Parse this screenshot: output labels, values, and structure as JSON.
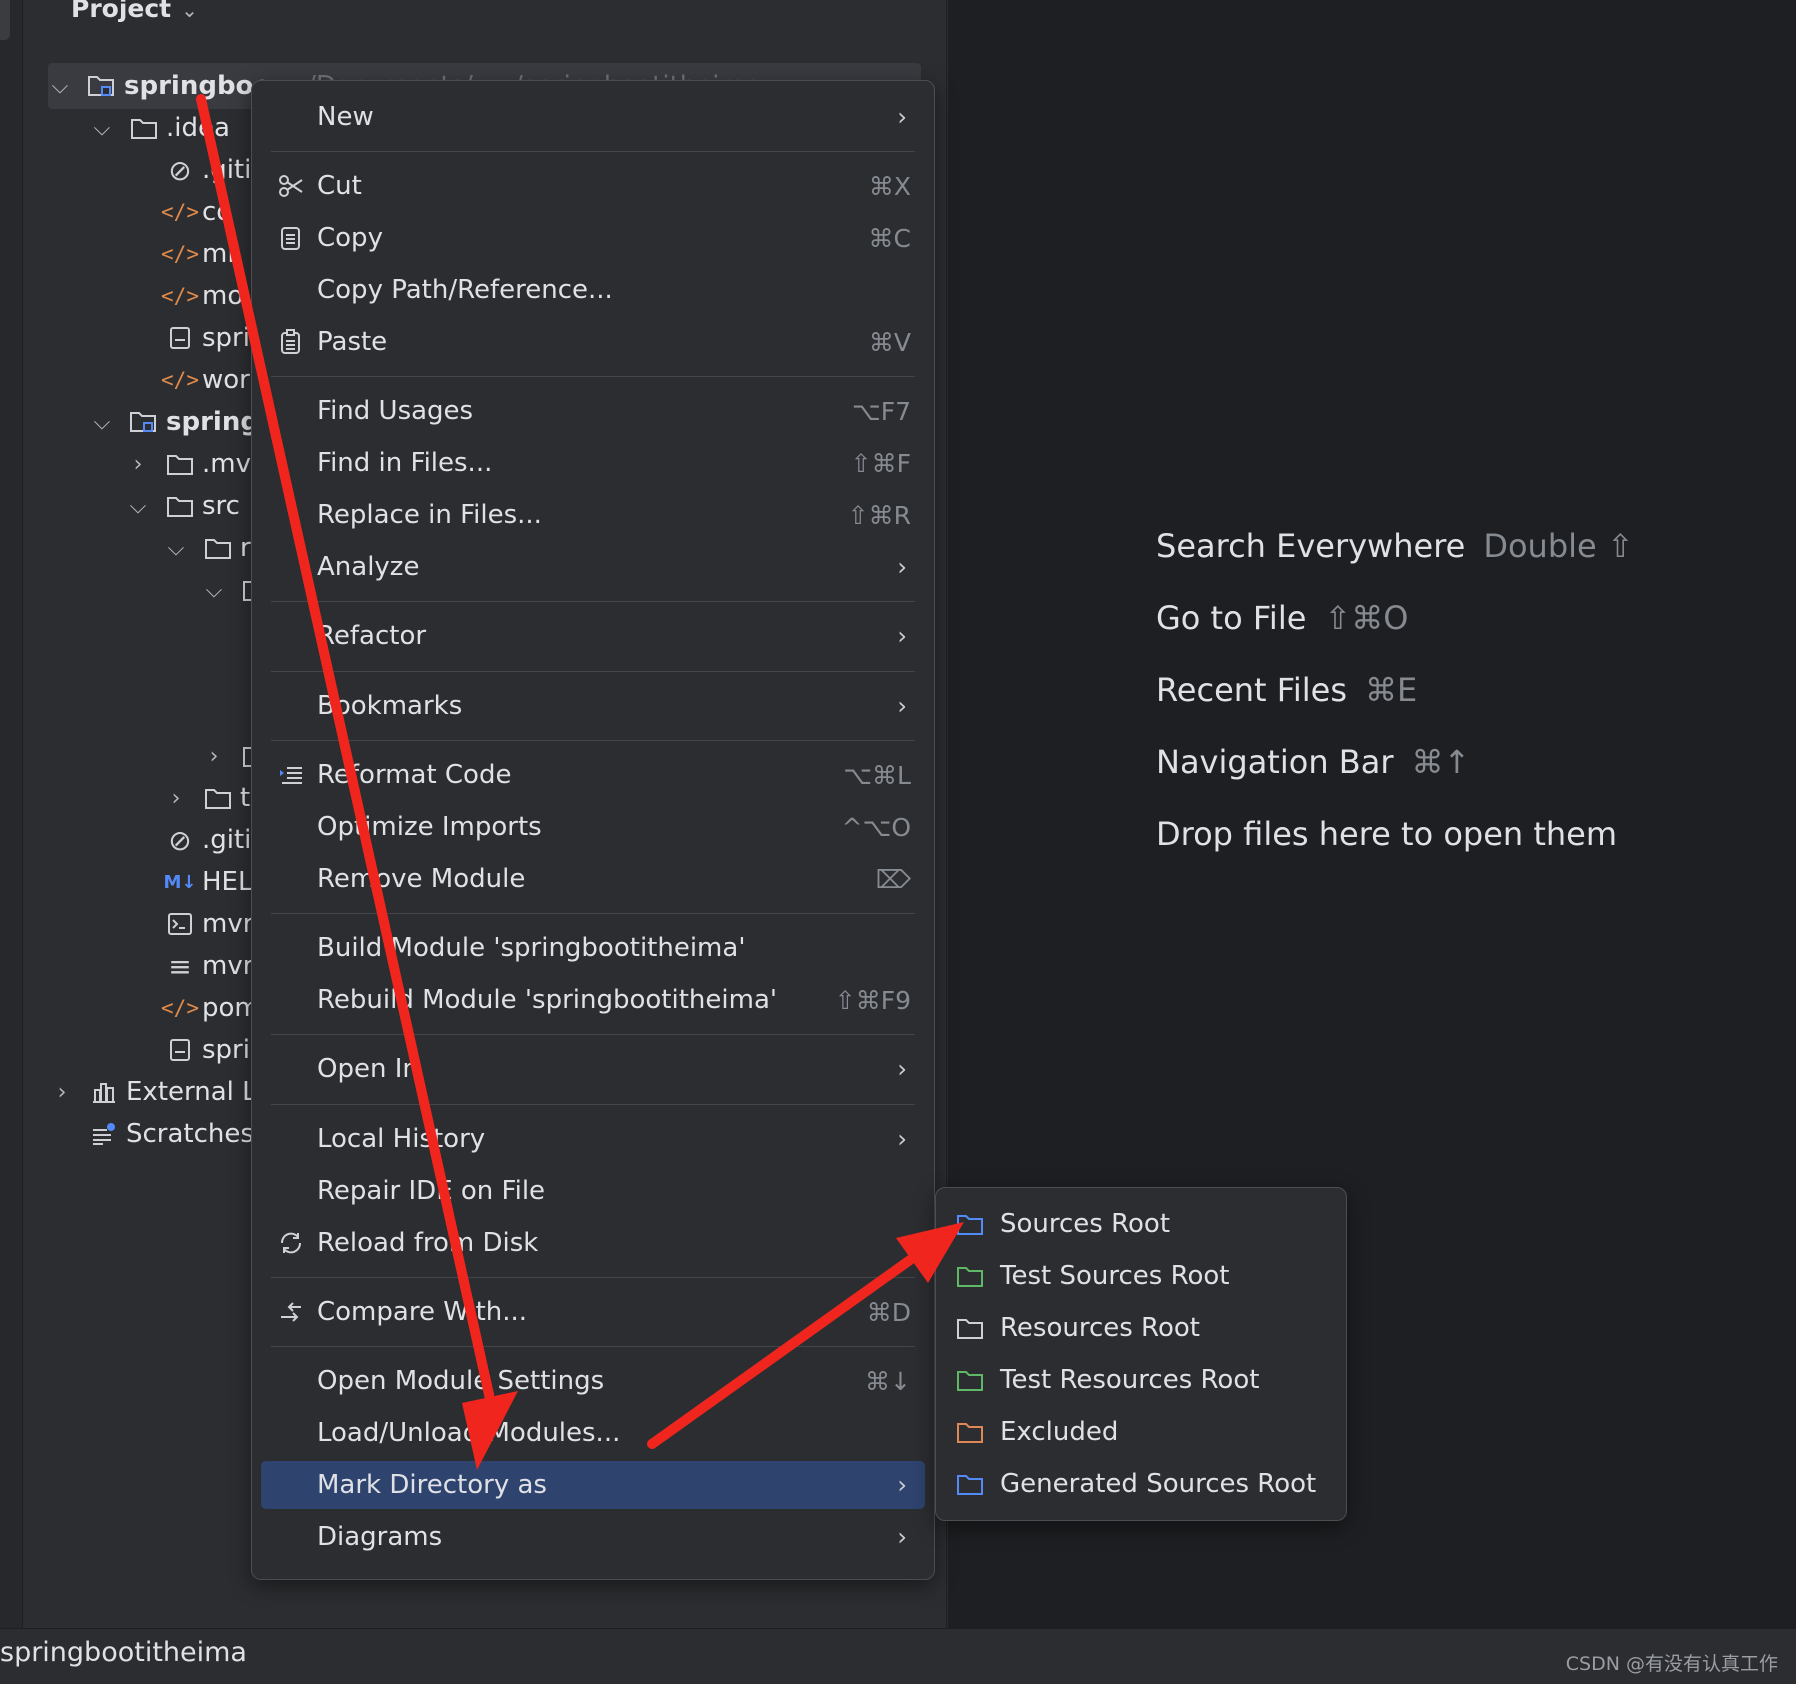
{
  "project_panel": {
    "title": "Project",
    "tree": [
      {
        "label": "springboo",
        "suffix": "~/Documents/ ... /springbootitheima",
        "kind": "module",
        "expanded": true
      },
      {
        "label": ".idea",
        "kind": "folder",
        "expanded": true
      },
      {
        "label": ".giti",
        "kind": "ignore"
      },
      {
        "label": "co",
        "kind": "xml"
      },
      {
        "label": "mi",
        "kind": "xml"
      },
      {
        "label": "mo",
        "kind": "xml"
      },
      {
        "label": "spri",
        "kind": "file"
      },
      {
        "label": "wor",
        "kind": "xml"
      },
      {
        "label": "springl",
        "kind": "module",
        "expanded": true
      },
      {
        "label": ".mv",
        "kind": "folder",
        "expanded": false
      },
      {
        "label": "src",
        "kind": "folder",
        "expanded": true
      },
      {
        "label": "r",
        "kind": "folder",
        "expanded": true
      },
      {
        "label": "",
        "kind": "folder",
        "expanded": true
      },
      {
        "label": "",
        "kind": "folder",
        "expanded": false
      },
      {
        "label": "t",
        "kind": "folder",
        "expanded": false
      },
      {
        "label": ".giti",
        "kind": "ignore"
      },
      {
        "label": "HEL",
        "kind": "markdown"
      },
      {
        "label": "mvr",
        "kind": "terminal"
      },
      {
        "label": "mvr",
        "kind": "text"
      },
      {
        "label": "pom",
        "kind": "xml"
      },
      {
        "label": "spri",
        "kind": "file"
      },
      {
        "label": "External L",
        "kind": "library",
        "expanded": false
      },
      {
        "label": "Scratches",
        "kind": "scratches"
      }
    ],
    "markdown_badge": "M↓"
  },
  "context_menu": {
    "items": [
      {
        "label": "New",
        "shortcut": "",
        "submenu": true,
        "icon": ""
      },
      {
        "label": "Cut",
        "shortcut": "⌘X",
        "submenu": false,
        "icon": "scissors-icon"
      },
      {
        "label": "Copy",
        "shortcut": "⌘C",
        "submenu": false,
        "icon": "copy-icon"
      },
      {
        "label": "Copy Path/Reference...",
        "shortcut": "",
        "submenu": false,
        "icon": ""
      },
      {
        "label": "Paste",
        "shortcut": "⌘V",
        "submenu": false,
        "icon": "paste-icon"
      },
      {
        "label": "Find Usages",
        "shortcut": "⌥F7",
        "submenu": false,
        "icon": ""
      },
      {
        "label": "Find in Files...",
        "shortcut": "⇧⌘F",
        "submenu": false,
        "icon": ""
      },
      {
        "label": "Replace in Files...",
        "shortcut": "⇧⌘R",
        "submenu": false,
        "icon": ""
      },
      {
        "label": "Analyze",
        "shortcut": "",
        "submenu": true,
        "icon": ""
      },
      {
        "label": "Refactor",
        "shortcut": "",
        "submenu": true,
        "icon": ""
      },
      {
        "label": "Bookmarks",
        "shortcut": "",
        "submenu": true,
        "icon": ""
      },
      {
        "label": "Reformat Code",
        "shortcut": "⌥⌘L",
        "submenu": false,
        "icon": "reformat-icon"
      },
      {
        "label": "Optimize Imports",
        "shortcut": "^⌥O",
        "submenu": false,
        "icon": ""
      },
      {
        "label": "Remove Module",
        "shortcut": "⌦",
        "submenu": false,
        "icon": ""
      },
      {
        "label": "Build Module 'springbootitheima'",
        "shortcut": "",
        "submenu": false,
        "icon": ""
      },
      {
        "label": "Rebuild Module 'springbootitheima'",
        "shortcut": "⇧⌘F9",
        "submenu": false,
        "icon": ""
      },
      {
        "label": "Open In",
        "shortcut": "",
        "submenu": true,
        "icon": ""
      },
      {
        "label": "Local History",
        "shortcut": "",
        "submenu": true,
        "icon": ""
      },
      {
        "label": "Repair IDE on File",
        "shortcut": "",
        "submenu": false,
        "icon": ""
      },
      {
        "label": "Reload from Disk",
        "shortcut": "",
        "submenu": false,
        "icon": "reload-icon"
      },
      {
        "label": "Compare With...",
        "shortcut": "⌘D",
        "submenu": false,
        "icon": "compare-icon"
      },
      {
        "label": "Open Module Settings",
        "shortcut": "⌘↓",
        "submenu": false,
        "icon": ""
      },
      {
        "label": "Load/Unload Modules...",
        "shortcut": "",
        "submenu": false,
        "icon": ""
      },
      {
        "label": "Mark Directory as",
        "shortcut": "",
        "submenu": true,
        "icon": "",
        "selected": true
      },
      {
        "label": "Diagrams",
        "shortcut": "",
        "submenu": true,
        "icon": ""
      }
    ]
  },
  "submenu": {
    "items": [
      {
        "label": "Sources Root",
        "color": "#548af7"
      },
      {
        "label": "Test Sources Root",
        "color": "#5fb865"
      },
      {
        "label": "Resources Root",
        "color": "#ced0d6"
      },
      {
        "label": "Test Resources Root",
        "color": "#5fb865"
      },
      {
        "label": "Excluded",
        "color": "#e08855"
      },
      {
        "label": "Generated Sources Root",
        "color": "#548af7"
      }
    ]
  },
  "welcome": {
    "hints": [
      {
        "label": "Search Everywhere",
        "shortcut": "Double ⇧"
      },
      {
        "label": "Go to File",
        "shortcut": "⇧⌘O"
      },
      {
        "label": "Recent Files",
        "shortcut": "⌘E"
      },
      {
        "label": "Navigation Bar",
        "shortcut": "⌘↑"
      },
      {
        "label": "Drop files here to open them",
        "shortcut": ""
      }
    ]
  },
  "status_bar": {
    "project_name": "springbootitheima",
    "watermark": "CSDN @有没有认真工作"
  },
  "colors": {
    "annotation_arrow": "#f0261e",
    "selection": "#2e436e",
    "panel_bg": "#2b2d30",
    "editor_bg": "#1e1f22"
  }
}
